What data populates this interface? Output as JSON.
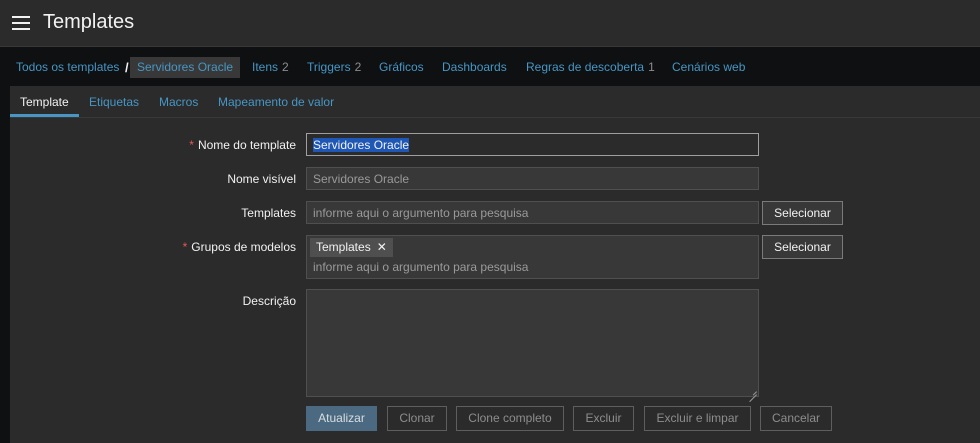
{
  "header": {
    "title": "Templates",
    "menu_icon": "hamburger-menu-icon"
  },
  "navbar": {
    "breadcrumb_root": "Todos os templates",
    "breadcrumb_separator": "/",
    "breadcrumb_current": "Servidores Oracle",
    "items": [
      {
        "label": "Itens",
        "count": "2"
      },
      {
        "label": "Triggers",
        "count": "2"
      },
      {
        "label": "Gráficos",
        "count": ""
      },
      {
        "label": "Dashboards",
        "count": ""
      },
      {
        "label": "Regras de descoberta",
        "count": "1"
      },
      {
        "label": "Cenários web",
        "count": ""
      }
    ]
  },
  "tabs": [
    {
      "label": "Template",
      "active": true
    },
    {
      "label": "Etiquetas",
      "active": false
    },
    {
      "label": "Macros",
      "active": false
    },
    {
      "label": "Mapeamento de valor",
      "active": false
    }
  ],
  "form": {
    "template_name": {
      "label": "Nome do template",
      "required": true,
      "value": "Servidores Oracle"
    },
    "visible_name": {
      "label": "Nome visível",
      "required": false,
      "placeholder": "Servidores Oracle"
    },
    "templates": {
      "label": "Templates",
      "placeholder": "informe aqui o argumento para pesquisa",
      "button": "Selecionar"
    },
    "groups": {
      "label": "Grupos de modelos",
      "required": true,
      "chip": "Templates",
      "placeholder": "informe aqui o argumento para pesquisa",
      "button": "Selecionar"
    },
    "description": {
      "label": "Descrição",
      "value": ""
    }
  },
  "buttons": {
    "update": "Atualizar",
    "clone": "Clonar",
    "full_clone": "Clone completo",
    "delete": "Excluir",
    "delete_clear": "Excluir e limpar",
    "cancel": "Cancelar"
  },
  "colors": {
    "link": "#4796c4",
    "background": "#2b2b2b",
    "required": "#e45959",
    "primary_button": "#4b6a82"
  }
}
